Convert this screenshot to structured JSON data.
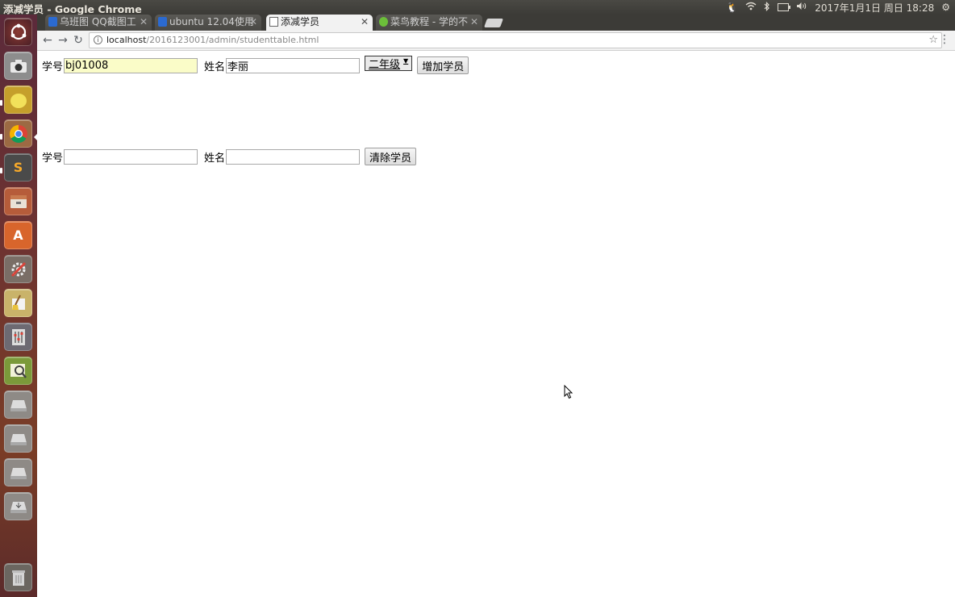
{
  "window_title": "添减学员 - Google Chrome",
  "top_panel": {
    "datetime": "2017年1月1日 周日 18:28"
  },
  "tabs": [
    {
      "label": "乌班图 QQ截图工",
      "favicon": "paw-icon"
    },
    {
      "label": "ubuntu 12.04使用",
      "favicon": "paw-icon"
    },
    {
      "label": "添减学员",
      "favicon": "page-icon"
    },
    {
      "label": "菜鸟教程 - 学的不",
      "favicon": "runoob-icon"
    }
  ],
  "address": {
    "host": "localhost",
    "path": "/2016123001/admin/studenttable.html"
  },
  "add_form": {
    "id_label": "学号",
    "id_value": "bj01008",
    "name_label": "姓名",
    "name_value": "李丽",
    "grade_selected": "二年级",
    "submit_label": "增加学员"
  },
  "remove_form": {
    "id_label": "学号",
    "id_value": "",
    "name_label": "姓名",
    "name_value": "",
    "submit_label": "清除学员"
  }
}
